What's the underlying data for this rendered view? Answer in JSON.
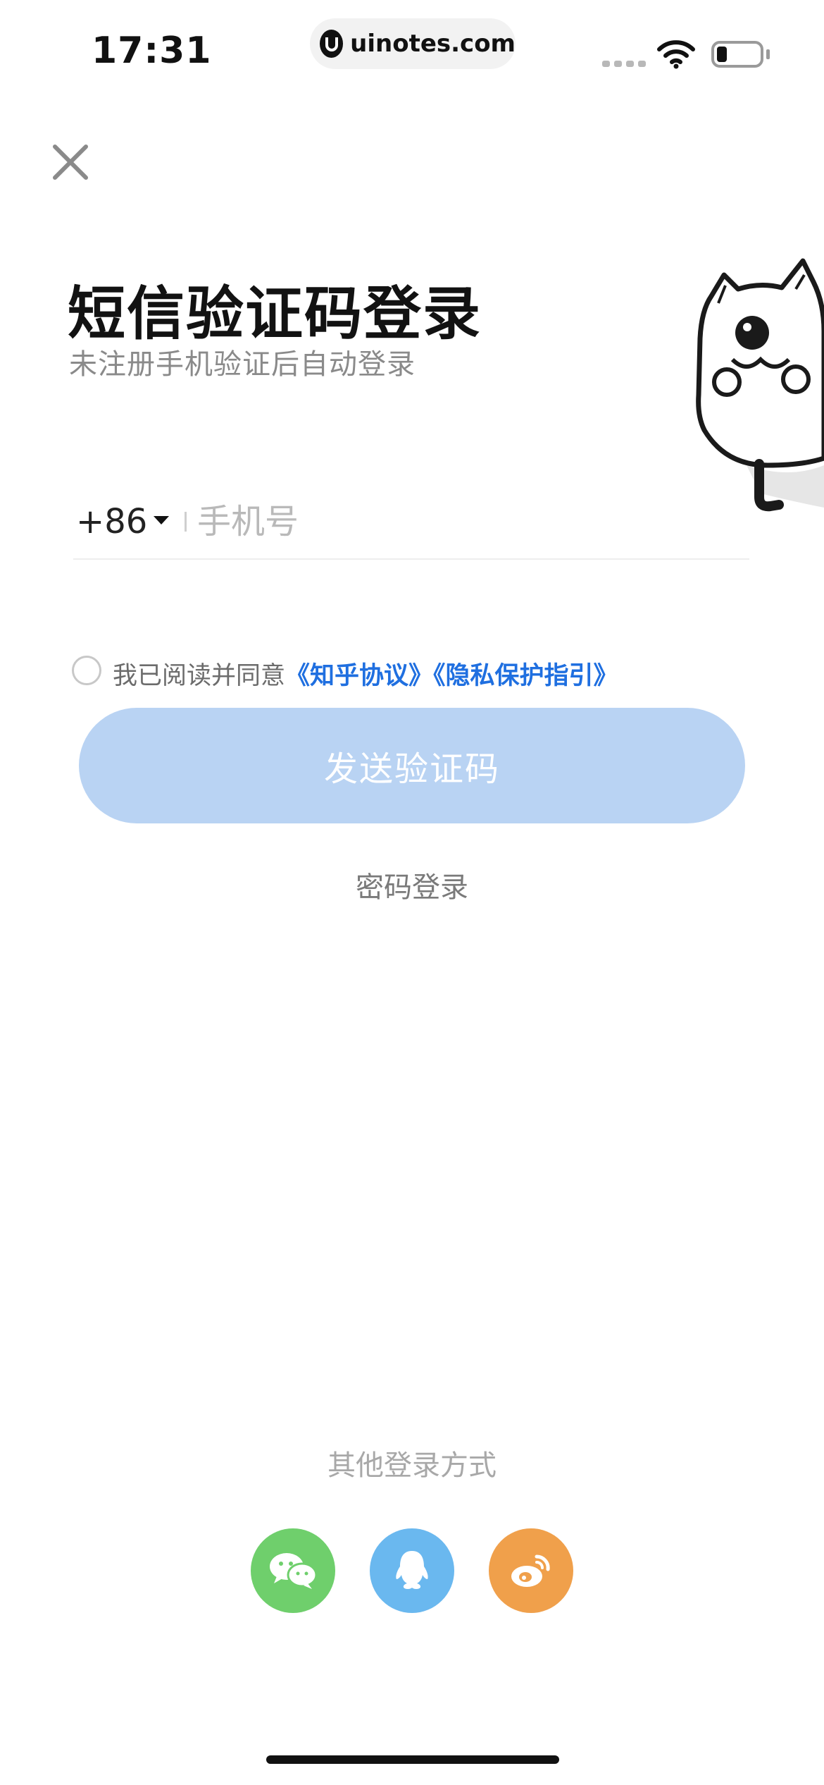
{
  "status_bar": {
    "time": "17:31",
    "url": "uinotes.com"
  },
  "header": {
    "close_icon": "close-icon"
  },
  "login": {
    "title": "短信验证码登录",
    "subtitle": "未注册手机验证后自动登录",
    "country_code": "+86",
    "phone_placeholder": "手机号",
    "phone_value": ""
  },
  "agreement": {
    "prefix": "我已阅读并同意",
    "link_terms": "《知乎协议》",
    "link_privacy": "《隐私保护指引》",
    "checked": false
  },
  "actions": {
    "send_code": "发送验证码",
    "password_login": "密码登录"
  },
  "other_login": {
    "label": "其他登录方式",
    "providers": [
      {
        "icon": "wechat-icon",
        "color": "#6fcf6c"
      },
      {
        "icon": "qq-icon",
        "color": "#6ab8ef"
      },
      {
        "icon": "weibo-icon",
        "color": "#f0a04b"
      }
    ]
  },
  "colors": {
    "accent_link": "#1f6fe0",
    "button_disabled": "#b9d3f3"
  }
}
